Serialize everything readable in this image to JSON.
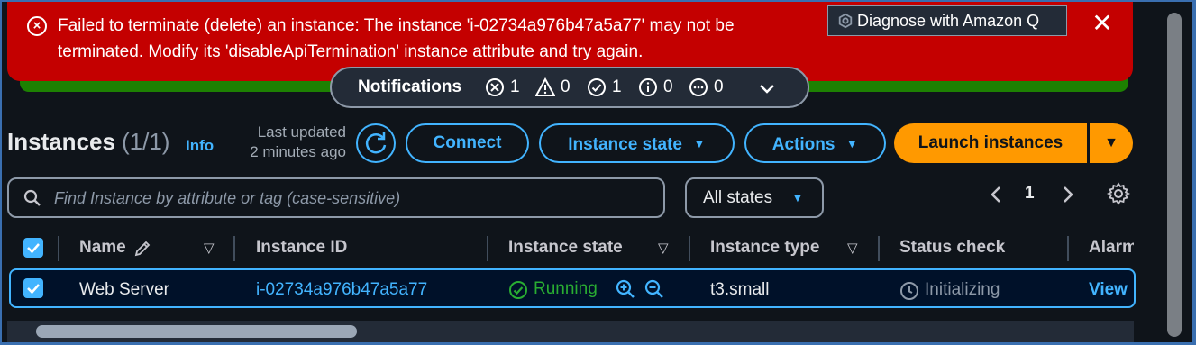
{
  "flash": {
    "message": "Failed to terminate (delete) an instance: The instance 'i-02734a976b47a5a77' may not be terminated. Modify its 'disableApiTermination' instance attribute and try again.",
    "diagnose_label": "Diagnose with Amazon Q"
  },
  "notifications": {
    "title": "Notifications",
    "errors": "1",
    "warnings": "0",
    "success": "1",
    "info": "0",
    "in_progress": "0"
  },
  "header": {
    "title": "Instances",
    "count": "(1/1)",
    "info": "Info",
    "last_updated_line1": "Last updated",
    "last_updated_line2": "2 minutes ago",
    "connect": "Connect",
    "instance_state": "Instance state",
    "actions": "Actions",
    "launch": "Launch instances"
  },
  "filter": {
    "placeholder": "Find Instance by attribute or tag (case-sensitive)",
    "states": "All states"
  },
  "pager": {
    "page": "1"
  },
  "table": {
    "columns": [
      "Name",
      "Instance ID",
      "Instance state",
      "Instance type",
      "Status check",
      "Alarm"
    ],
    "rows": [
      {
        "name": "Web Server",
        "instance_id": "i-02734a976b47a5a77",
        "state": "Running",
        "type": "t3.small",
        "status": "Initializing",
        "alarm": "View"
      }
    ]
  },
  "colors": {
    "error": "#c40000",
    "accent": "#42b4ff",
    "primary": "#ff9900",
    "success": "#29ad32"
  }
}
